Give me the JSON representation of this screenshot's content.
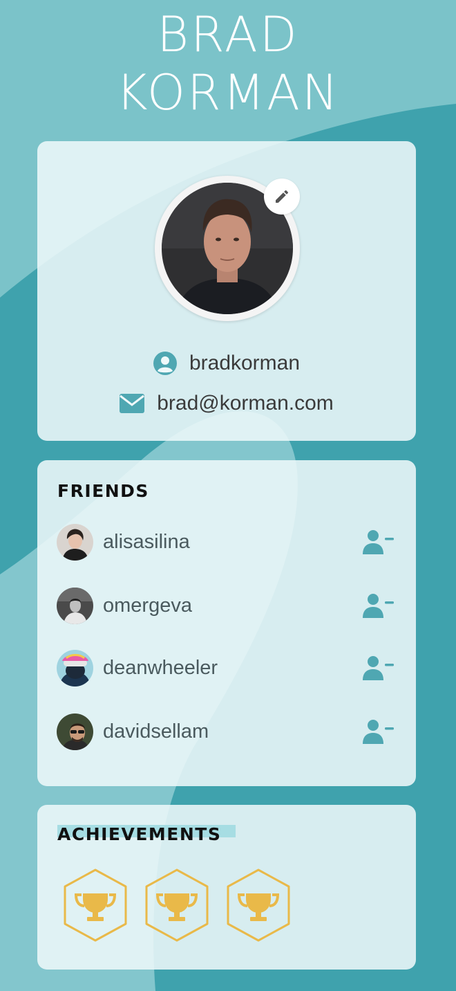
{
  "profile": {
    "first_name": "BRAD",
    "last_name": "KORMAN",
    "username": "bradkorman",
    "email": "brad@korman.com"
  },
  "friends": {
    "title": "FRIENDS",
    "items": [
      {
        "name": "alisasilina"
      },
      {
        "name": "omergeva"
      },
      {
        "name": "deanwheeler"
      },
      {
        "name": "davidsellam"
      }
    ]
  },
  "achievements": {
    "title": "ACHIEVEMENTS",
    "badges": [
      {
        "icon": "trophy-icon"
      },
      {
        "icon": "trophy-icon"
      },
      {
        "icon": "trophy-icon"
      }
    ]
  },
  "colors": {
    "background": "#3fa2ad",
    "accent": "#4fa7b2",
    "badge": "#e9b949"
  }
}
